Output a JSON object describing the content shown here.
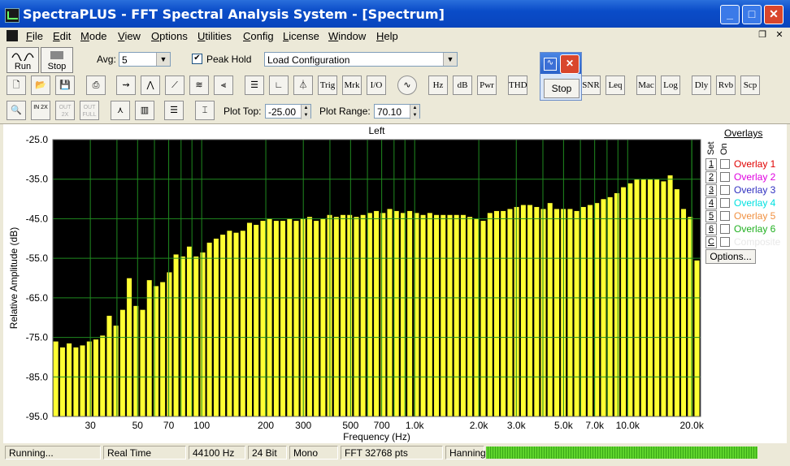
{
  "window": {
    "title": "SpectraPLUS - FFT Spectral Analysis System - [Spectrum]"
  },
  "menu": [
    "File",
    "Edit",
    "Mode",
    "View",
    "Options",
    "Utilities",
    "Config",
    "License",
    "Window",
    "Help"
  ],
  "toolbar1": {
    "run_label": "Run",
    "stop_label": "Stop",
    "avg_label": "Avg:",
    "avg_value": "5",
    "peak_hold_label": "Peak Hold",
    "peak_hold_checked": true,
    "config_value": "Load Configuration"
  },
  "toolbar2": {
    "text_buttons": [
      "Trig",
      "Mrk",
      "I/O",
      "Hz",
      "dB",
      "Pwr",
      "THD",
      "SNR",
      "Leq",
      "Mac",
      "Log",
      "Dly",
      "Rvb",
      "Scp"
    ]
  },
  "toolbar3": {
    "zoom_in_label": "IN 2X",
    "zoom_out_label": "OUT 2X",
    "zoom_full_label": "OUT FULL",
    "plot_top_label": "Plot Top:",
    "plot_top_value": "-25.00",
    "plot_range_label": "Plot Range:",
    "plot_range_value": "70.10"
  },
  "floating_window": {
    "stop_label": "Stop"
  },
  "chart_data": {
    "type": "bar",
    "title": "Left",
    "xlabel": "Frequency (Hz)",
    "ylabel": "Relative Amplitude (dB)",
    "x_scale": "log",
    "xlim": [
      20,
      22000
    ],
    "ylim": [
      -95,
      -25
    ],
    "grid": true,
    "background": "#000000",
    "bar_color": "#ffff33",
    "grid_color": "#1f8a1f",
    "y_ticks": [
      "-25.0",
      "-35.0",
      "-45.0",
      "-55.0",
      "-65.0",
      "-75.0",
      "-85.0",
      "-95.0"
    ],
    "x_ticks": [
      {
        "value": 30,
        "label": "30"
      },
      {
        "value": 50,
        "label": "50"
      },
      {
        "value": 70,
        "label": "70"
      },
      {
        "value": 100,
        "label": "100"
      },
      {
        "value": 200,
        "label": "200"
      },
      {
        "value": 300,
        "label": "300"
      },
      {
        "value": 500,
        "label": "500"
      },
      {
        "value": 700,
        "label": "700"
      },
      {
        "value": 1000,
        "label": "1.0k"
      },
      {
        "value": 2000,
        "label": "2.0k"
      },
      {
        "value": 3000,
        "label": "3.0k"
      },
      {
        "value": 5000,
        "label": "5.0k"
      },
      {
        "value": 7000,
        "label": "7.0k"
      },
      {
        "value": 10000,
        "label": "10.0k"
      },
      {
        "value": 20000,
        "label": "20.0k"
      }
    ],
    "values": [
      -76,
      -77.5,
      -76.5,
      -77.5,
      -77,
      -76,
      -75.5,
      -74.5,
      -69.5,
      -72,
      -68,
      -60,
      -67,
      -68,
      -60.5,
      -62,
      -61,
      -58.5,
      -54,
      -54.5,
      -52,
      -54.5,
      -53.5,
      -51,
      -50,
      -49,
      -48,
      -48.5,
      -48,
      -46,
      -46.5,
      -45.5,
      -45,
      -45.5,
      -45.5,
      -45,
      -45.5,
      -45,
      -44.5,
      -45.5,
      -45,
      -44,
      -44.5,
      -44,
      -44,
      -44.5,
      -44,
      -43.5,
      -43,
      -43.5,
      -42.5,
      -43,
      -43.5,
      -43,
      -43.5,
      -44,
      -43.5,
      -44,
      -44,
      -44,
      -44,
      -44,
      -44.5,
      -45,
      -45.5,
      -43.5,
      -43,
      -43,
      -42.5,
      -42,
      -41.5,
      -41.5,
      -42,
      -42.5,
      -41,
      -42.5,
      -42.5,
      -42.5,
      -43,
      -42,
      -41.5,
      -41,
      -40,
      -39.5,
      -38.5,
      -37,
      -36,
      -35,
      -35,
      -35,
      -35,
      -35.5,
      -34,
      -37.5,
      -42.5,
      -44.5,
      -55.5
    ]
  },
  "overlays": {
    "title": "Overlays",
    "set_header": "Set",
    "on_header": "On",
    "items": [
      {
        "num": "1",
        "label": "Overlay 1",
        "color": "#e00000"
      },
      {
        "num": "2",
        "label": "Overlay 2",
        "color": "#e000e0"
      },
      {
        "num": "3",
        "label": "Overlay 3",
        "color": "#3030c0"
      },
      {
        "num": "4",
        "label": "Overlay 4",
        "color": "#00e0e0"
      },
      {
        "num": "5",
        "label": "Overlay 5",
        "color": "#f09040"
      },
      {
        "num": "6",
        "label": "Overlay 6",
        "color": "#20b020"
      },
      {
        "num": "C",
        "label": "Composite",
        "color": "#e8e8e8"
      }
    ],
    "options_label": "Options..."
  },
  "status": {
    "state": "Running...",
    "mode": "Real Time",
    "rate": "44100 Hz",
    "bits": "24 Bit",
    "channels": "Mono",
    "fft": "FFT 32768 pts",
    "window": "Hanning",
    "level_fraction": 1.0
  }
}
